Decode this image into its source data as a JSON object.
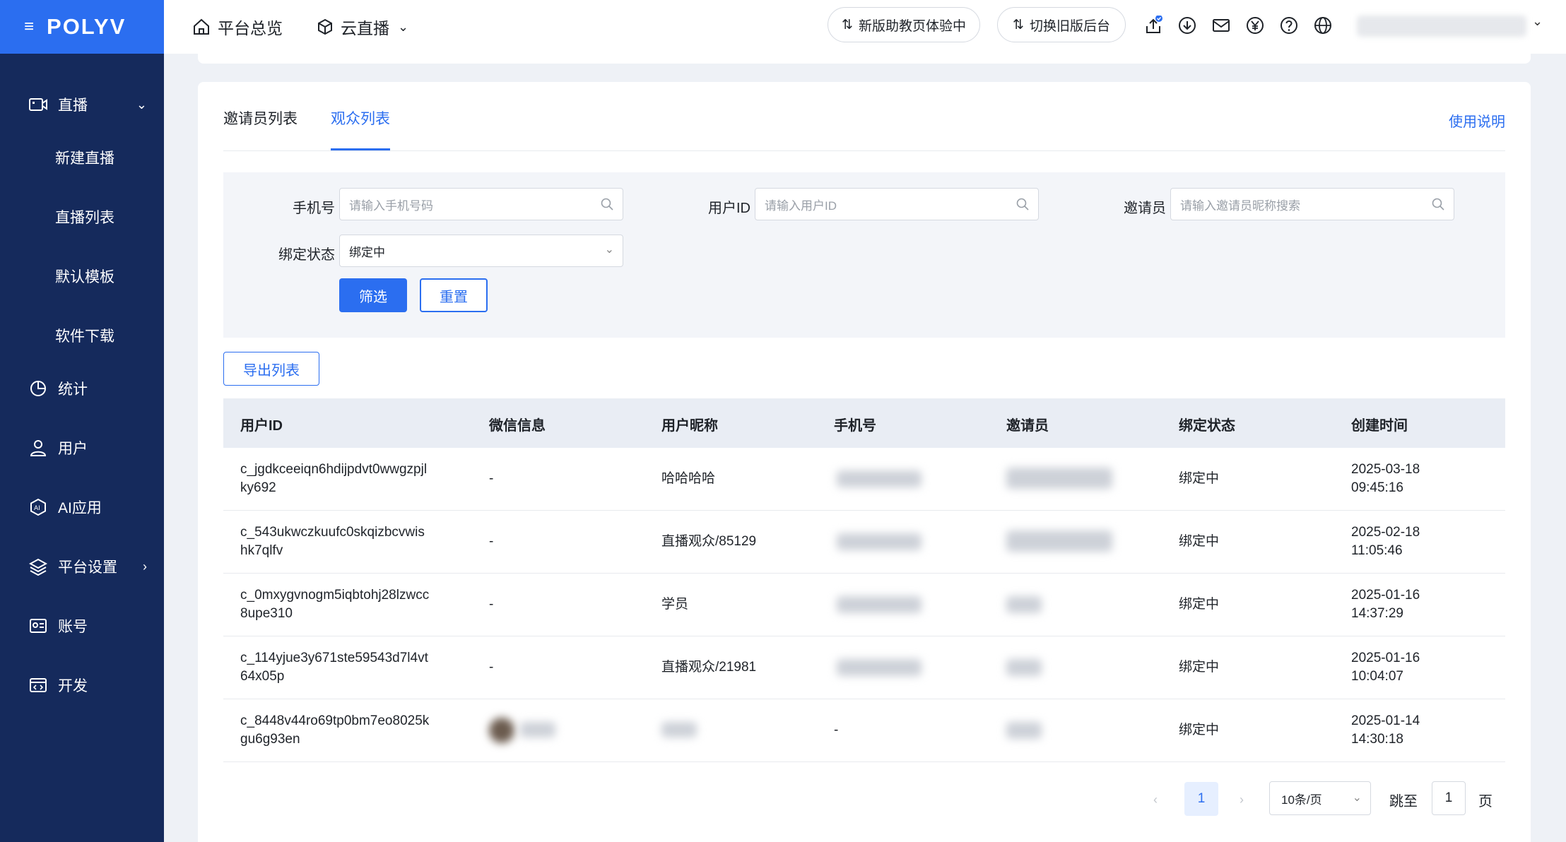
{
  "sidebar": {
    "logo": "POLYV",
    "items": [
      {
        "label": "直播",
        "icon": "live-camera-icon"
      },
      {
        "label": "新建直播"
      },
      {
        "label": "直播列表"
      },
      {
        "label": "默认模板"
      },
      {
        "label": "软件下载"
      },
      {
        "label": "统计",
        "icon": "chart-pie-icon"
      },
      {
        "label": "用户",
        "icon": "user-icon"
      },
      {
        "label": "AI应用",
        "icon": "ai-icon"
      },
      {
        "label": "平台设置",
        "icon": "layers-icon"
      },
      {
        "label": "账号",
        "icon": "id-card-icon"
      },
      {
        "label": "开发",
        "icon": "code-icon"
      }
    ]
  },
  "header": {
    "overview": "平台总览",
    "cloud_live": "云直播",
    "new_assistant": "新版助教页体验中",
    "switch_old": "切换旧版后台"
  },
  "tabs": {
    "inviter_list": "邀请员列表",
    "audience_list": "观众列表",
    "help": "使用说明"
  },
  "filters": {
    "phone_label": "手机号",
    "phone_placeholder": "请输入手机号码",
    "userid_label": "用户ID",
    "userid_placeholder": "请输入用户ID",
    "inviter_label": "邀请员",
    "inviter_placeholder": "请输入邀请员昵称搜索",
    "bind_label": "绑定状态",
    "bind_value": "绑定中",
    "filter_btn": "筛选",
    "reset_btn": "重置"
  },
  "export_btn": "导出列表",
  "table": {
    "headers": [
      "用户ID",
      "微信信息",
      "用户昵称",
      "手机号",
      "邀请员",
      "绑定状态",
      "创建时间"
    ],
    "rows": [
      {
        "uid1": "c_jgdkceeiqn6hdijpdvt0wwgzpjl",
        "uid2": "ky692",
        "wechat": "-",
        "nick": "哈哈哈哈",
        "status": "绑定中",
        "date": "2025-03-18",
        "time": "09:45:16"
      },
      {
        "uid1": "c_543ukwczkuufc0skqizbcvwis",
        "uid2": "hk7qlfv",
        "wechat": "-",
        "nick": "直播观众/85129",
        "status": "绑定中",
        "date": "2025-02-18",
        "time": "11:05:46"
      },
      {
        "uid1": "c_0mxygvnogm5iqbtohj28lzwcc",
        "uid2": "8upe310",
        "wechat": "-",
        "nick": "学员",
        "status": "绑定中",
        "date": "2025-01-16",
        "time": "14:37:29"
      },
      {
        "uid1": "c_114yjue3y671ste59543d7l4vt",
        "uid2": "64x05p",
        "wechat": "-",
        "nick": "直播观众/21981",
        "status": "绑定中",
        "date": "2025-01-16",
        "time": "10:04:07"
      },
      {
        "uid1": "c_8448v44ro69tp0bm7eo8025k",
        "uid2": "gu6g93en",
        "phone": "-",
        "status": "绑定中",
        "date": "2025-01-14",
        "time": "14:30:18"
      }
    ]
  },
  "pagination": {
    "current": "1",
    "page_size": "10条/页",
    "jump_label": "跳至",
    "jump_value": "1",
    "page_suffix": "页"
  }
}
